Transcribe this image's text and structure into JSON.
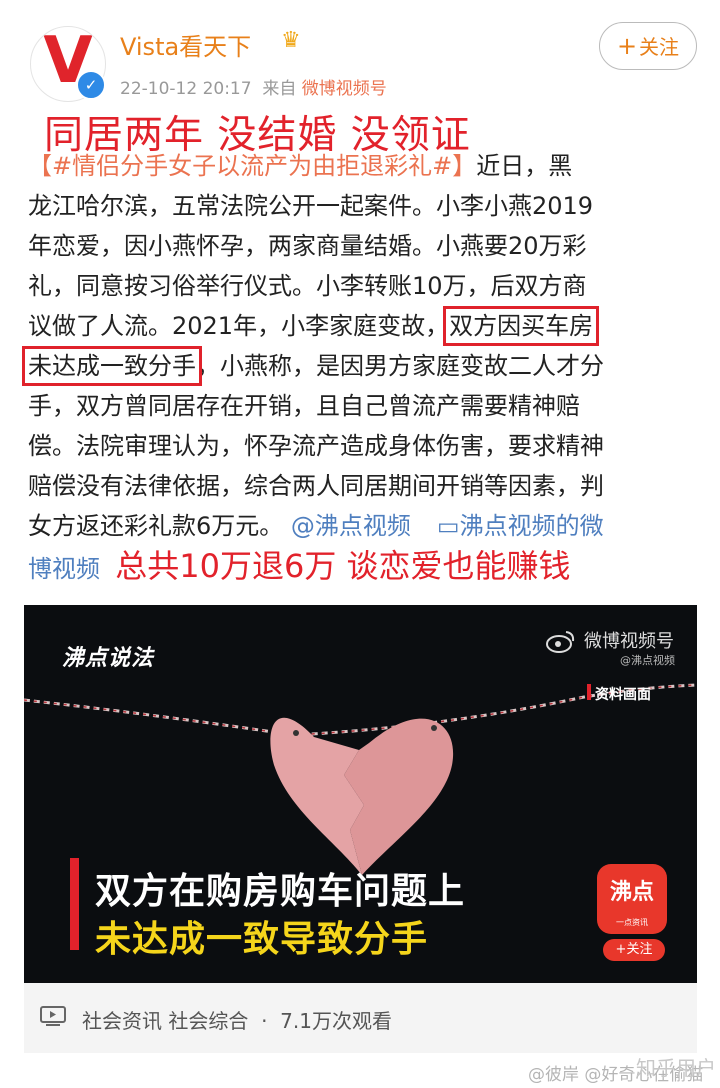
{
  "post": {
    "username": "Vista看天下",
    "crown_icon": "crown-icon",
    "date": "22-10-12 20:17",
    "source_prefix": "来自",
    "source": "微博视频号",
    "follow_label": "关注",
    "overlay_title": "同居两年 没结婚 没领证",
    "hashtag": "【#情侣分手女子以流产为由拒退彩礼#】",
    "lines": {
      "l1_rest": "近日，黑",
      "l2": "龙江哈尔滨，五常法院公开一起案件。小李小燕2019",
      "l3": "年恋爱，因小燕怀孕，两家商量结婚。小燕要20万彩",
      "l4": "礼，同意按习俗举行仪式。小李转账10万，后双方商",
      "l5_a": "议做了人流。2021年，小李家庭变故，",
      "l5_hl": "双方因买车房",
      "l6_hl": "未达成一致分手",
      "l6_b": "，小燕称，是因男方家庭变故二人才分",
      "l7": "手，双方曾同居存在开销，且自己曾流产需要精神赔",
      "l8": "偿。法院审理认为，怀孕流产造成身体伤害，要求精神",
      "l9": "赔偿没有法律依据，综合两人同居期间开销等因素，判",
      "l10_a": "女方返还彩礼款6万元。",
      "mention": "@沸点视频",
      "video_link": "沸点视频的微",
      "video_link_2": "博视频",
      "overlay_comment": "总共10万退6万  谈恋爱也能赚钱"
    }
  },
  "video": {
    "brand": "沸点说法",
    "weibo_label": "微博视频号",
    "weibo_sub": "@沸点视频",
    "tag": "资料画面",
    "caption1": "双方在购房购车问题上",
    "caption2": "未达成一致导致分手",
    "logo_text": "沸点",
    "logo_sub": "一点资讯",
    "logo_follow": "+关注"
  },
  "footer": {
    "category1": "社会资讯",
    "category2": "社会综合",
    "dot": "·",
    "views": "7.1万次观看"
  },
  "watermark": {
    "text": "@彼岸 @好奇心在偷猫",
    "site": "知乎用户"
  }
}
